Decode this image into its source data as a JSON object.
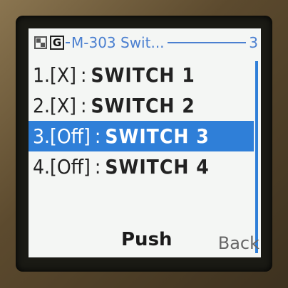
{
  "header": {
    "title": "M-303 Swit...",
    "page": "3",
    "g_badge": "G",
    "network_icon": "network-icon"
  },
  "items": [
    {
      "index": "1.",
      "state": "[X]",
      "sep": ":",
      "name": "SWITCH 1",
      "selected": false
    },
    {
      "index": "2.",
      "state": "[X]",
      "sep": ":",
      "name": "SWITCH 2",
      "selected": false
    },
    {
      "index": "3.",
      "state": "[Off]",
      "sep": ":",
      "name": "SWITCH 3",
      "selected": true
    },
    {
      "index": "4.",
      "state": "[Off]",
      "sep": ":",
      "name": "SWITCH 4",
      "selected": false
    }
  ],
  "softkeys": {
    "center": "Push",
    "right": "Back"
  },
  "colors": {
    "accent": "#2f7fd8",
    "screen_bg": "#f4f6f4"
  }
}
